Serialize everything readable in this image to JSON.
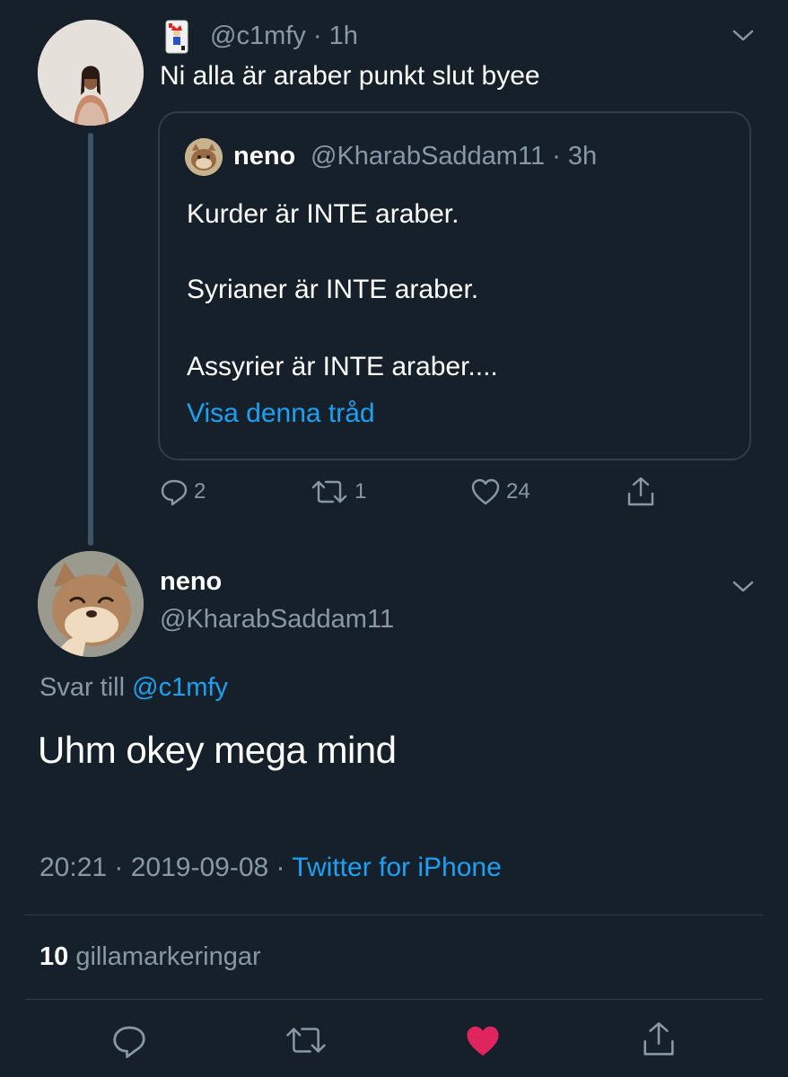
{
  "parent_tweet": {
    "handle": "@c1mfy",
    "time": "1h",
    "text": "Ni alla är araber punkt slut byee",
    "reply_count": "2",
    "retweet_count": "1",
    "like_count": "24"
  },
  "quoted_tweet": {
    "name": "neno",
    "handle": "@KharabSaddam11",
    "time": "3h",
    "lines": [
      "Kurder är INTE araber.",
      "Syrianer är INTE araber.",
      "Assyrier är INTE araber...."
    ],
    "show_thread": "Visa denna tråd"
  },
  "main_tweet": {
    "name": "neno",
    "handle": "@KharabSaddam11",
    "reply_prefix": "Svar till",
    "reply_to": "@c1mfy",
    "text": "Uhm okey mega mind",
    "time": "20:21",
    "date": "2019-09-08",
    "source": "Twitter for iPhone",
    "likes_count": "10",
    "likes_label": "gillamarkeringar"
  },
  "colors": {
    "background": "#15202b",
    "secondary_text": "#8899a6",
    "link": "#1da1f2",
    "liked": "#e0245e",
    "border": "#2f3d4a"
  },
  "icons": [
    "joker-card-icon",
    "chevron-down-icon",
    "reply-icon",
    "retweet-icon",
    "like-icon",
    "share-icon"
  ]
}
